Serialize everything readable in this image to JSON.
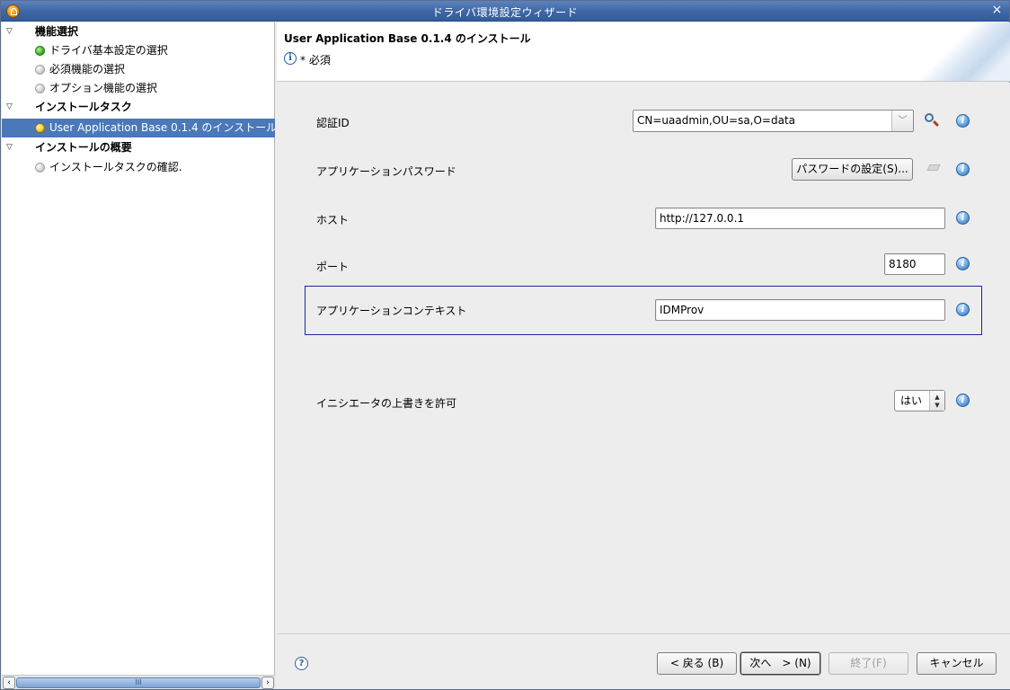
{
  "window": {
    "title": "ドライバ環境設定ウィザード",
    "close_glyph": "×",
    "app_icon": "novell-designer-icon"
  },
  "tree": {
    "groups": [
      {
        "label": "機能選択",
        "expanded": true,
        "items": [
          {
            "label": "ドライバ基本設定の選択",
            "status": "complete",
            "status_color": "#37a81c"
          },
          {
            "label": "必須機能の選択",
            "status": "pending",
            "status_color": "#c9c9c9"
          },
          {
            "label": "オプション機能の選択",
            "status": "pending",
            "status_color": "#c9c9c9"
          }
        ]
      },
      {
        "label": "インストールタスク",
        "expanded": true,
        "items": [
          {
            "label": "User Application Base 0.1.4 のインストール",
            "status": "current",
            "status_color": "#f2c21c",
            "selected": true
          }
        ]
      },
      {
        "label": "インストールの概要",
        "expanded": true,
        "items": [
          {
            "label": "インストールタスクの確認.",
            "status": "pending",
            "status_color": "#c9c9c9"
          }
        ]
      }
    ],
    "scroll_grip": "III"
  },
  "header": {
    "title": "User Application Base 0.1.4 のインストール",
    "required_note": "* 必須",
    "required_icon": "i"
  },
  "form": {
    "auth_id": {
      "label": "認証ID",
      "value": "CN=uaadmin,OU=sa,O=data"
    },
    "app_password": {
      "label": "アプリケーションパスワード",
      "button": "パスワードの設定(S)..."
    },
    "host": {
      "label": "ホスト",
      "value": "http://127.0.0.1"
    },
    "port": {
      "label": "ポート",
      "value": "8180"
    },
    "app_context": {
      "label": "アプリケーションコンテキスト",
      "value": "IDMProv"
    },
    "allow_initiator_override": {
      "label": "イニシエータの上書きを許可",
      "value": "はい"
    },
    "info_glyph": "i"
  },
  "footer": {
    "help_glyph": "?",
    "back": "< 戻る (B)",
    "next": "次へ　> (N)",
    "finish": "終了(F)",
    "cancel": "キャンセル"
  },
  "colors": {
    "selection": "#4a78b9",
    "title_bar": "#3f68a6",
    "focus_border": "#1a2a9c"
  }
}
